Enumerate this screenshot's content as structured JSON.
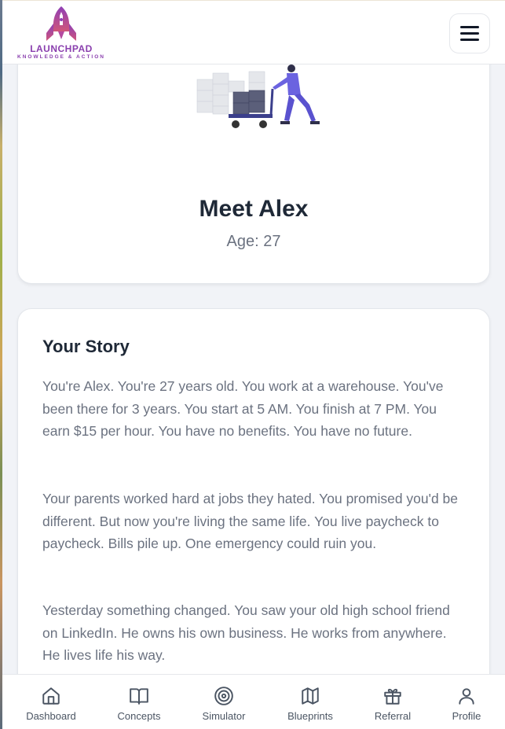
{
  "header": {
    "logo_title": "LAUNCHPAD",
    "logo_tagline": "KNOWLEDGE & ACTION",
    "menu_icon": "hamburger-menu-icon"
  },
  "profile": {
    "illustration": "warehouse-worker-pushing-cart",
    "name": "Meet Alex",
    "age": "Age: 27"
  },
  "story": {
    "title": "Your Story",
    "paragraphs": [
      "You're Alex. You're 27 years old. You work at a warehouse. You've been there for 3 years. You start at 5 AM. You finish at 7 PM. You earn $15 per hour. You have no benefits. You have no future.",
      "Your parents worked hard at jobs they hated. You promised you'd be different. But now you're living the same life. You live paycheck to paycheck. Bills pile up. One emergency could ruin you.",
      "Yesterday something changed. You saw your old high school friend on LinkedIn. He owns his own business. He works from anywhere. He lives life his way."
    ]
  },
  "nav": {
    "items": [
      {
        "label": "Dashboard",
        "icon": "home-icon"
      },
      {
        "label": "Concepts",
        "icon": "book-icon"
      },
      {
        "label": "Simulator",
        "icon": "target-icon"
      },
      {
        "label": "Blueprints",
        "icon": "map-icon"
      },
      {
        "label": "Referral",
        "icon": "gift-icon"
      },
      {
        "label": "Profile",
        "icon": "user-icon"
      }
    ]
  },
  "colors": {
    "brand": "#8a3fae",
    "text_dark": "#1f2937",
    "text_muted": "#6b7280",
    "background": "#f1f3f7"
  }
}
